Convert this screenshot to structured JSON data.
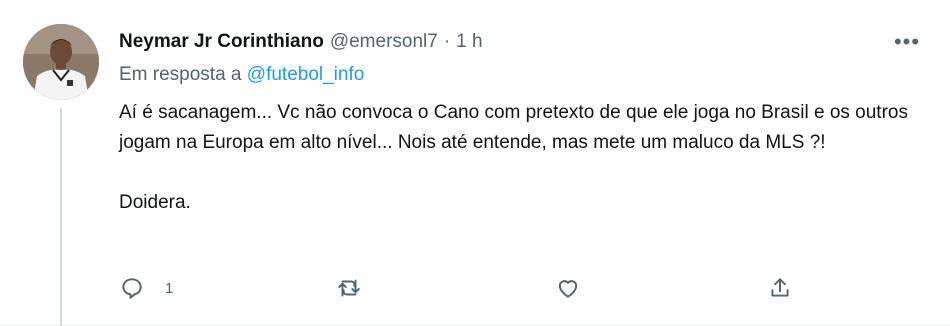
{
  "tweet": {
    "author_name": "Neymar Jr Corinthiano",
    "handle": "@emersonl7",
    "separator": "·",
    "time": "1 h",
    "more_label": "•••",
    "reply_prefix": "Em resposta a",
    "reply_to_handle": "@futebol_info",
    "paragraphs": [
      "Aí é sacanagem... Vc não convoca o Cano com pretexto de que ele joga no Brasil e os outros jogam na Europa em alto nível... Nois até entende, mas mete um maluco da MLS ?!",
      "Doidera."
    ],
    "actions": {
      "reply_count": "1",
      "retweet_count": "",
      "like_count": ""
    }
  },
  "colors": {
    "text": "#0f1419",
    "secondary": "#536471",
    "link": "#1d9bf0",
    "thread_line": "#cfd9de"
  }
}
